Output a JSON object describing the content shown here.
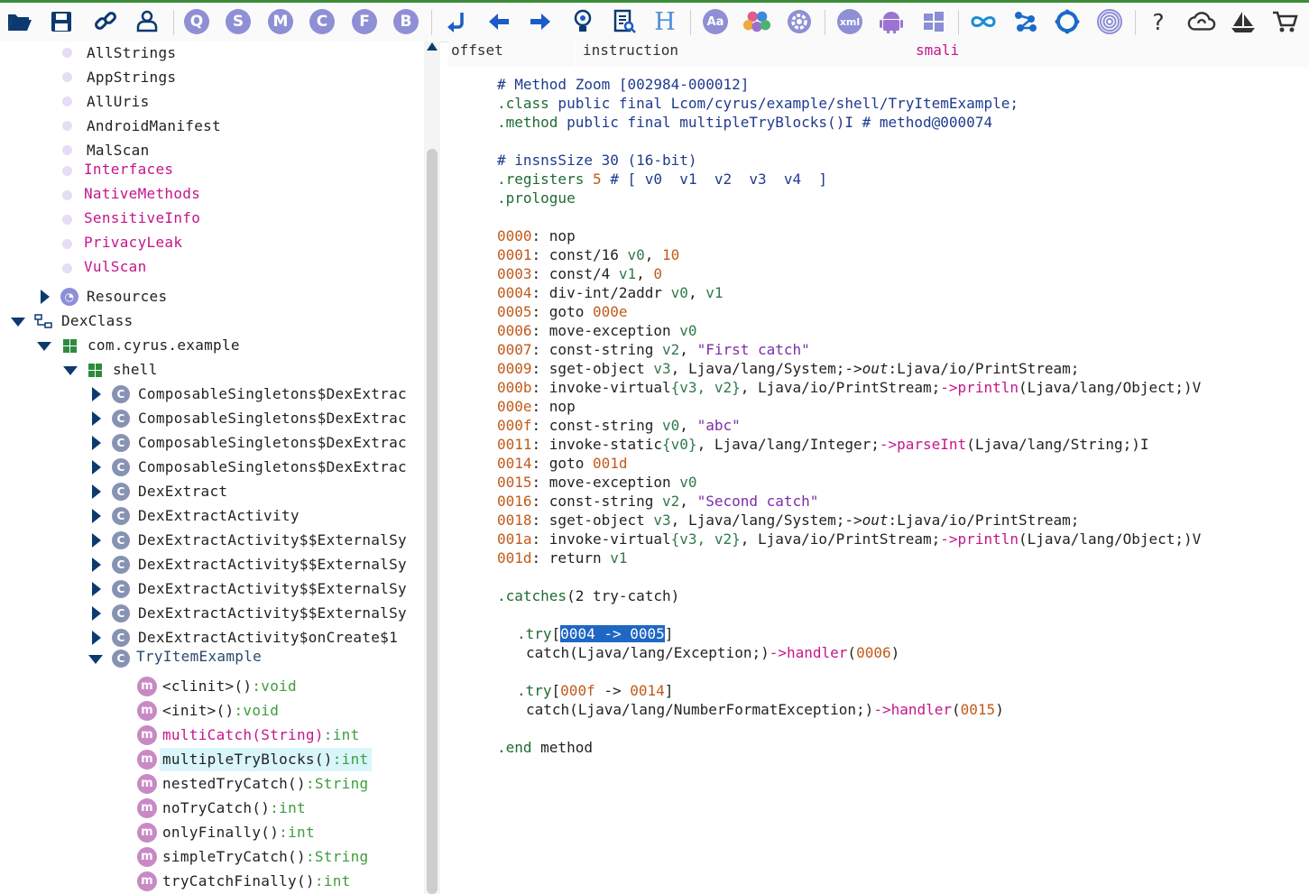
{
  "toolbar": {
    "icons": [
      "open-folder",
      "save",
      "link",
      "user-export",
      "q-circle",
      "s-circle",
      "m-circle",
      "c-circle",
      "f-circle",
      "b-circle",
      "arrow-left-hook",
      "arrow-left",
      "arrow-right",
      "bulb",
      "document-search",
      "h-letter",
      "aa-circle",
      "flower",
      "gear",
      "xml-circle",
      "android",
      "windows",
      "infinity",
      "network",
      "circle-ring",
      "fingerprint",
      "help",
      "cloud",
      "ship",
      "cart"
    ],
    "circle_letters": {
      "q": "Q",
      "s": "S",
      "m": "M",
      "c": "C",
      "f": "F",
      "b": "B"
    },
    "help_label": "?",
    "h_label": "H",
    "aa_label": "Aa",
    "xml_label": "xml"
  },
  "tree": {
    "analysis_items": [
      {
        "label": "AllStrings",
        "style": "plain"
      },
      {
        "label": "AppStrings",
        "style": "plain"
      },
      {
        "label": "AllUris",
        "style": "plain"
      },
      {
        "label": "AndroidManifest",
        "style": "plain"
      },
      {
        "label": "MalScan",
        "style": "plain"
      },
      {
        "label": "Interfaces",
        "style": "pink"
      },
      {
        "label": "NativeMethods",
        "style": "pink"
      },
      {
        "label": "SensitiveInfo",
        "style": "pink"
      },
      {
        "label": "PrivacyLeak",
        "style": "pink"
      },
      {
        "label": "VulScan",
        "style": "pink"
      }
    ],
    "resources": "Resources",
    "dexclass": "DexClass",
    "package": "com.cyrus.example",
    "subpackage": "shell",
    "classes": [
      "ComposableSingletons$DexExtrac",
      "ComposableSingletons$DexExtrac",
      "ComposableSingletons$DexExtrac",
      "ComposableSingletons$DexExtrac",
      "DexExtract",
      "DexExtractActivity",
      "DexExtractActivity$$ExternalSy",
      "DexExtractActivity$$ExternalSy",
      "DexExtractActivity$$ExternalSy",
      "DexExtractActivity$$ExternalSy",
      "DexExtractActivity$onCreate$1"
    ],
    "expanded_class": "TryItemExample",
    "class_icon_letter": "C",
    "method_icon_letter": "m",
    "methods": [
      {
        "name": "<clinit>()",
        "type": ":void",
        "style": "plain"
      },
      {
        "name": "<init>()",
        "type": ":void",
        "style": "plain"
      },
      {
        "name": "multiCatch(String)",
        "type": ":int",
        "style": "pink"
      },
      {
        "name": "multipleTryBlocks()",
        "type": ":int",
        "style": "plain",
        "selected": true
      },
      {
        "name": "nestedTryCatch()",
        "type": ":String",
        "style": "plain"
      },
      {
        "name": "noTryCatch()",
        "type": ":int",
        "style": "plain"
      },
      {
        "name": "onlyFinally()",
        "type": ":int",
        "style": "plain"
      },
      {
        "name": "simpleTryCatch()",
        "type": ":String",
        "style": "plain"
      },
      {
        "name": "tryCatchFinally()",
        "type": ":int",
        "style": "plain"
      }
    ]
  },
  "columns": {
    "offset": "offset",
    "instruction": "instruction",
    "smali": "smali"
  },
  "code": {
    "method_zoom": "# Method Zoom [002984-000012]",
    "class_kw": ".class",
    "class_rest": " public final Lcom/cyrus/example/shell/TryItemExample;",
    "method_kw": ".method",
    "method_rest": " public final multipleTryBlocks()I # method@000074",
    "insns": "# insnsSize 30 (16-bit)",
    "registers_kw": ".registers",
    "registers_num": "5",
    "registers_rest": " # [ v0  v1  v2  v3  v4  ]",
    "prologue": ".prologue",
    "lines": {
      "l0000": {
        "off": "0000",
        "op": "nop"
      },
      "l0001": {
        "off": "0001",
        "op": "const/16",
        "a": "v0",
        "b": "10"
      },
      "l0003": {
        "off": "0003",
        "op": "const/4",
        "a": "v1",
        "b": "0"
      },
      "l0004": {
        "off": "0004",
        "op": "div-int/2addr",
        "a": "v0",
        "b": "v1"
      },
      "l0005": {
        "off": "0005",
        "op": "goto",
        "t": "000e"
      },
      "l0006": {
        "off": "0006",
        "op": "move-exception",
        "a": "v0"
      },
      "l0007": {
        "off": "0007",
        "op": "const-string",
        "a": "v2",
        "s": "\"First catch\""
      },
      "l0009": {
        "off": "0009",
        "op": "sget-object",
        "a": "v3",
        "cls": "Ljava/lang/System;",
        "arrow": "->",
        "f": "out",
        "fr": ":Ljava/io/PrintStream;"
      },
      "l000b": {
        "off": "000b",
        "op": "invoke-virtual",
        "args": "{v3, v2}",
        "cls": "Ljava/io/PrintStream;",
        "arrow": "->",
        "m": "println",
        "sig": "(Ljava/lang/Object;)V"
      },
      "l000e": {
        "off": "000e",
        "op": "nop"
      },
      "l000f": {
        "off": "000f",
        "op": "const-string",
        "a": "v0",
        "s": "\"abc\""
      },
      "l0011": {
        "off": "0011",
        "op": "invoke-static",
        "args": "{v0}",
        "cls": "Ljava/lang/Integer;",
        "arrow": "->",
        "m": "parseInt",
        "sig": "(Ljava/lang/String;)I"
      },
      "l0014": {
        "off": "0014",
        "op": "goto",
        "t": "001d"
      },
      "l0015": {
        "off": "0015",
        "op": "move-exception",
        "a": "v0"
      },
      "l0016": {
        "off": "0016",
        "op": "const-string",
        "a": "v2",
        "s": "\"Second catch\""
      },
      "l0018": {
        "off": "0018",
        "op": "sget-object",
        "a": "v3",
        "cls": "Ljava/lang/System;",
        "arrow": "->",
        "f": "out",
        "fr": ":Ljava/io/PrintStream;"
      },
      "l001a": {
        "off": "001a",
        "op": "invoke-virtual",
        "args": "{v3, v2}",
        "cls": "Ljava/io/PrintStream;",
        "arrow": "->",
        "m": "println",
        "sig": "(Ljava/lang/Object;)V"
      },
      "l001d": {
        "off": "001d",
        "op": "return",
        "a": "v1"
      }
    },
    "catches_kw": ".catches",
    "catches_rest": "(2 try-catch)",
    "try1": {
      "kw": ".try",
      "range": "0004 -> 0005",
      "catch": "catch(Ljava/lang/Exception;)",
      "arrow": "->",
      "handler": "handler",
      "h": "0006"
    },
    "try2": {
      "kw": ".try",
      "from": "000f",
      "mid": " -> ",
      "to": "0014",
      "catch": "catch(Ljava/lang/NumberFormatException;)",
      "arrow": "->",
      "handler": "handler",
      "h": "0015"
    },
    "end": ".end",
    "end_rest": " method"
  },
  "colors": {
    "accent_green": "#3c8d3a",
    "pink": "#c4168a",
    "selection": "#1f67c4",
    "orange": "#c15a1b",
    "purple": "#7b2da8"
  }
}
